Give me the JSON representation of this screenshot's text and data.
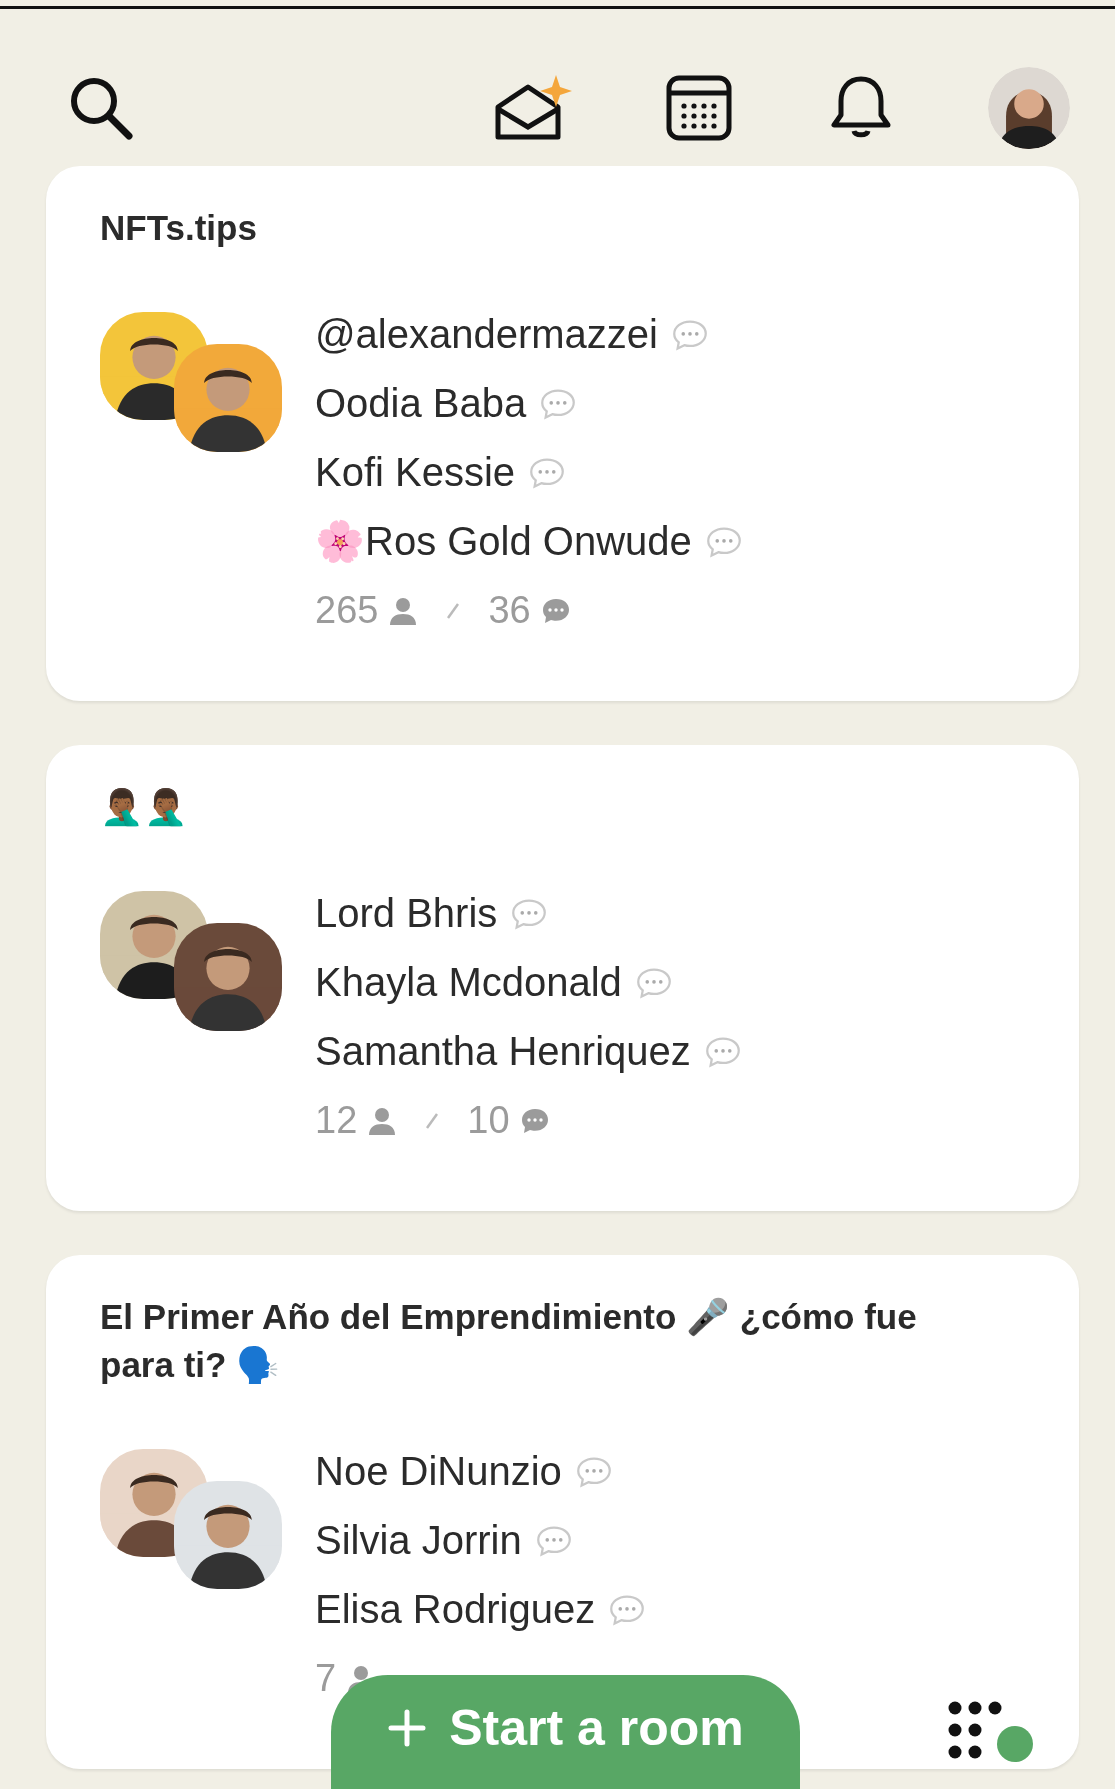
{
  "rooms": [
    {
      "title": "NFTs.tips",
      "speakers": [
        {
          "name": "@alexandermazzei"
        },
        {
          "name": "Oodia Baba"
        },
        {
          "name": "Kofi Kessie"
        },
        {
          "name": "🌸Ros Gold Onwude"
        }
      ],
      "listeners": "265",
      "chats": "36"
    },
    {
      "title": "🤦🏾‍♂️🤦🏾‍♂️",
      "speakers": [
        {
          "name": "Lord Bhris"
        },
        {
          "name": "Khayla Mcdonald"
        },
        {
          "name": "Samantha Henriquez"
        }
      ],
      "listeners": "12",
      "chats": "10"
    },
    {
      "title": "El Primer Año del Emprendimiento 🎤 ¿cómo fue para ti? 🗣️",
      "speakers": [
        {
          "name": "Noe DiNunzio"
        },
        {
          "name": "Silvia Jorrin"
        },
        {
          "name": "Elisa Rodriguez"
        }
      ],
      "listeners": "7"
    }
  ],
  "start_button": {
    "label": "Start a room"
  }
}
